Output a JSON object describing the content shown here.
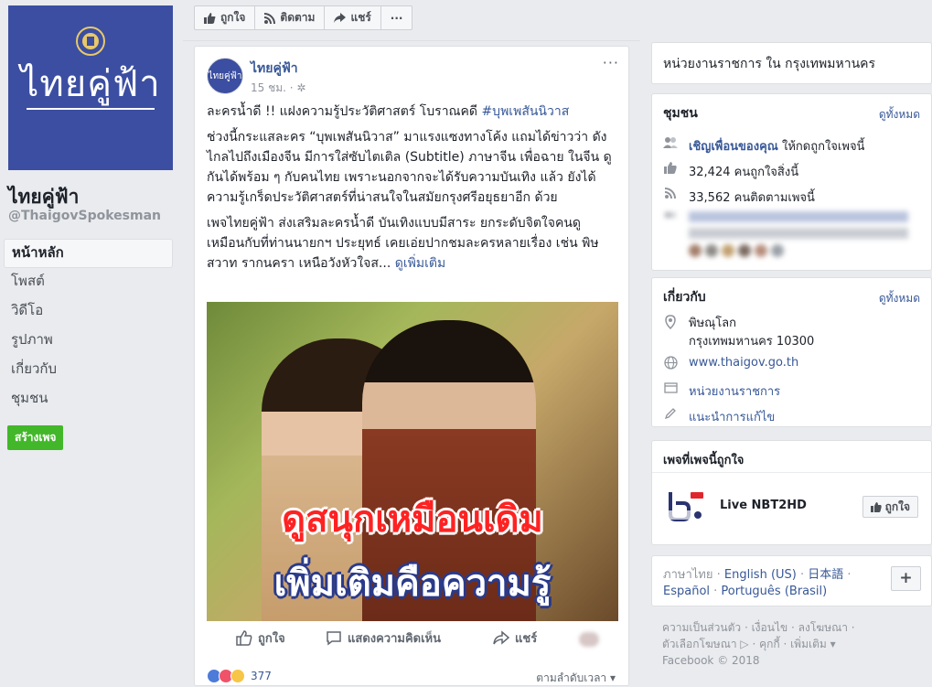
{
  "page": {
    "cover_text": "ไทยคู่ฟ้า",
    "name": "ไทยคู่ฟ้า",
    "handle": "@ThaigovSpokesman"
  },
  "left_nav": {
    "items": [
      {
        "label": "หน้าหลัก",
        "active": true
      },
      {
        "label": "โพสต์"
      },
      {
        "label": "วิดีโอ"
      },
      {
        "label": "รูปภาพ"
      },
      {
        "label": "เกี่ยวกับ"
      },
      {
        "label": "ชุมชน"
      }
    ],
    "create_page": "สร้างเพจ"
  },
  "actionbar": {
    "like": "ถูกใจ",
    "follow": "ติดตาม",
    "share": "แชร์",
    "more": "···"
  },
  "post": {
    "author": "ไทยคู่ฟ้า",
    "time": "15 ชม.",
    "more": "···",
    "line1_text": "ละครน้ำดี !! แฝงความรู้ประวัติศาสตร์ โบราณคดี ",
    "line1_hashtag": "#บุพเพสันนิวาส",
    "para2": "ช่วงนี้กระแสละคร “บุพเพสันนิวาส” มาแรงแซงทางโค้ง แถมได้ข่าวว่า ดังไกลไปถึงเมืองจีน มีการใส่ซับไตเติล (Subtitle) ภาษาจีน เพื่อฉาย ในจีน ดูกันได้พร้อม ๆ กับคนไทย เพราะนอกจากจะได้รับความบันเทิง แล้ว ยังได้ความรู้เกร็ดประวัติศาสตร์ที่น่าสนใจในสมัยกรุงศรีอยุธยาอีก ด้วย",
    "para3": "เพจไทยคู่ฟ้า ส่งเสริมละครน้ำดี บันเทิงแบบมีสาระ ยกระดับจิตใจคนดู เหมือนกับที่ท่านนายกฯ ประยุทธ์ เคยเอ่ยปากชมละครหลายเรื่อง เช่น พิษสวาท รากนครา เหนือวังหัวใจส... ",
    "see_more": "ดูเพิ่มเติม",
    "image_caption1": "ดูสนุกเหมือนเดิม",
    "image_caption2": "เพิ่มเติมคือความรู้",
    "actions": {
      "like": "ถูกใจ",
      "comment": "แสดงความคิดเห็น",
      "share": "แชร์"
    },
    "reaction_count": "377",
    "sort_label": "ตามลำดับเวลา ▾"
  },
  "right": {
    "category": "หน่วยงานราชการ ใน กรุงเทพมหานคร",
    "community": {
      "title": "ชุมชน",
      "see_all": "ดูทั้งหมด",
      "invite_link": "เชิญเพื่อนของคุณ",
      "invite_rest": " ให้กดถูกใจเพจนี้",
      "likes": "32,424 คนถูกใจสิ่งนี้",
      "follows": "33,562 คนติดตามเพจนี้"
    },
    "about": {
      "title": "เกี่ยวกับ",
      "see_all": "ดูทั้งหมด",
      "address1": "พิษณุโลก",
      "address2": "กรุงเทพมหานคร 10300",
      "website": "www.thaigov.go.th",
      "category": "หน่วยงานราชการ",
      "suggest": "แนะนำการแก้ไข"
    },
    "liked_pages": {
      "title": "เพจที่เพจนี้ถูกใจ",
      "page_name": "Live NBT2HD",
      "like_button": "ถูกใจ"
    },
    "languages": {
      "current": "ภาษาไทย",
      "others": [
        "English (US)",
        "日本語",
        "Español",
        "Português (Brasil)"
      ],
      "plus": "+"
    },
    "footer": {
      "line1": "ความเป็นส่วนตัว · เงื่อนไข · ลงโฆษณา ·",
      "line2": "ตัวเลือกโฆษณา ▷ · คุกกี้ · เพิ่มเติม ▾",
      "line3": "Facebook © 2018"
    }
  },
  "colors": {
    "brand_blue": "#3b4ea1",
    "link": "#385898",
    "create_green": "#42b72a",
    "background": "#e9ebee"
  },
  "icons": [
    "thumbs-up-icon",
    "rss-icon",
    "share-arrow-icon",
    "comment-icon",
    "people-icon",
    "location-pin-icon",
    "globe-icon",
    "folder-icon",
    "pencil-icon"
  ]
}
